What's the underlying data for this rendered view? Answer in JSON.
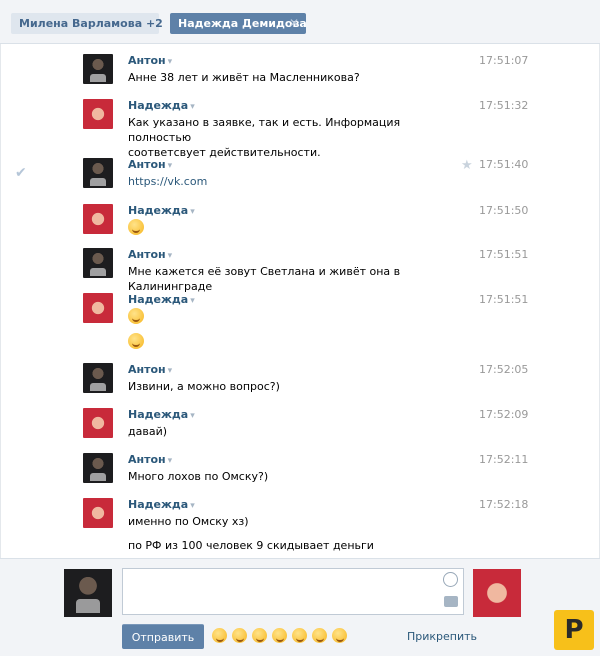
{
  "tabs": [
    {
      "label": "Милена Варламова +2",
      "close": "✕"
    },
    {
      "label": "Надежда Демидова",
      "close": "✕"
    }
  ],
  "messages": [
    {
      "author": "Антон",
      "time": "17:51:07",
      "lines": [
        "Анне 38 лет и живёт на Масленникова?"
      ]
    },
    {
      "author": "Надежда",
      "time": "17:51:32",
      "lines": [
        "Как указано в заявке, так и есть. Информация полностью",
        "соответсвует действительности."
      ]
    },
    {
      "author": "Антон",
      "time": "17:51:40",
      "link": "https://vk.com",
      "checked": true,
      "starred": true
    },
    {
      "author": "Надежда",
      "time": "17:51:50",
      "emoji": "crying-face"
    },
    {
      "author": "Антон",
      "time": "17:51:51",
      "lines": [
        "Мне кажется её зовут Светлана и живёт она в Калининграде"
      ]
    },
    {
      "author": "Надежда",
      "time": "17:51:51",
      "emoji": "winking-face",
      "emoji2": "smiling-face"
    },
    {
      "author": "Антон",
      "time": "17:52:05",
      "lines": [
        "Извини, а можно вопрос?)"
      ]
    },
    {
      "author": "Надежда",
      "time": "17:52:09",
      "lines": [
        "давай)"
      ]
    },
    {
      "author": "Антон",
      "time": "17:52:11",
      "lines": [
        "Много лохов по Омску?)"
      ]
    },
    {
      "author": "Надежда",
      "time": "17:52:18",
      "lines": [
        "именно по Омску хз)"
      ]
    }
  ],
  "extra_line": "по РФ из 100 человек 9 скидывает деньги",
  "composer": {
    "send_label": "Отправить",
    "attach_label": "Прикрепить",
    "emoji_bar": [
      "grin",
      "smile",
      "laugh",
      "kiss",
      "rolling-eyes",
      "wink",
      "heart-eyes"
    ]
  },
  "caret": "▾",
  "check_mark": "✔",
  "star": "★",
  "badge_letter": "P"
}
